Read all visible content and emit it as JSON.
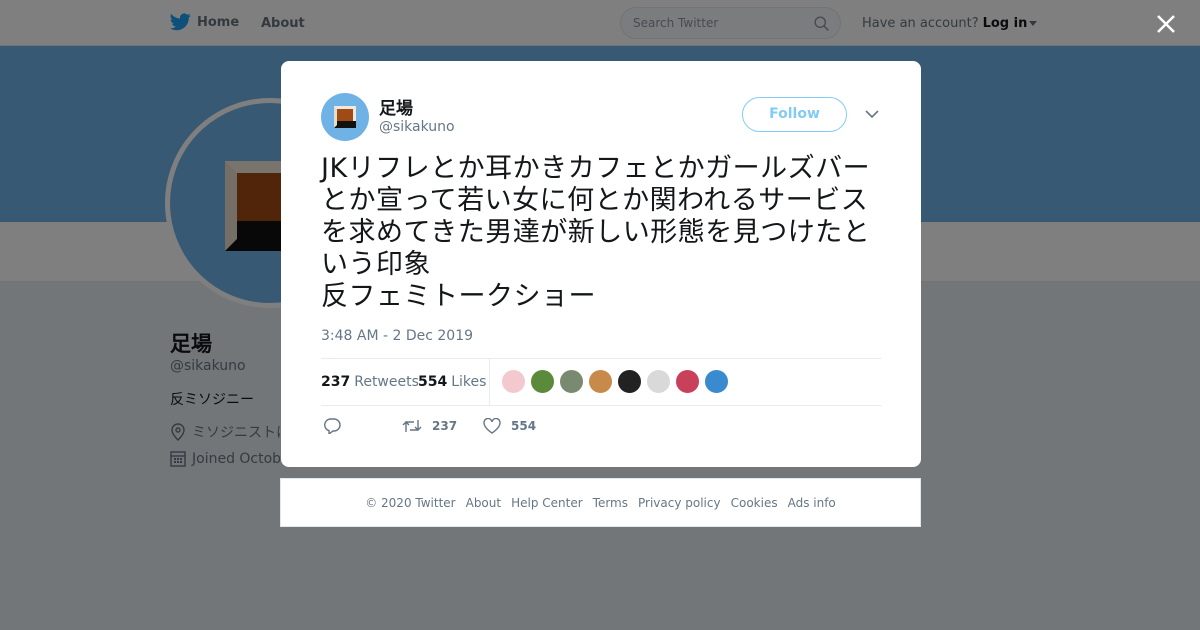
{
  "topbar": {
    "home_label": "Home",
    "about_label": "About",
    "search_placeholder": "Search Twitter",
    "have_account": "Have an account?",
    "login_label": "Log in"
  },
  "profile": {
    "name": "足場",
    "handle": "@sikakuno",
    "bio": "反ミソジニー",
    "location": "ミソジニストに",
    "joined": "Joined Octobe"
  },
  "tweet": {
    "author_name": "足場",
    "author_handle": "@sikakuno",
    "follow_label": "Follow",
    "text": "JKリフレとか耳かきカフェとかガールズバーとか宣って若い女に何とか関われるサービスを求めてきた男達が新しい形態を見つけたという印象\n反フェミトークショー",
    "timestamp": "3:48 AM - 2 Dec 2019",
    "retweets_count": "237",
    "retweets_label": "Retweets",
    "likes_count": "554",
    "likes_label": "Likes",
    "action_retweets": "237",
    "action_likes": "554",
    "liker_colors": [
      "#f3c9cf",
      "#5a8a3a",
      "#7a8a70",
      "#c88a4a",
      "#222222",
      "#d9d9d9",
      "#c8405a",
      "#3a8ad0"
    ]
  },
  "footer": {
    "links": [
      "© 2020 Twitter",
      "About",
      "Help Center",
      "Terms",
      "Privacy policy",
      "Cookies",
      "Ads info"
    ]
  },
  "colors": {
    "accent": "#1da1f2",
    "banner": "#6fb2e6"
  }
}
